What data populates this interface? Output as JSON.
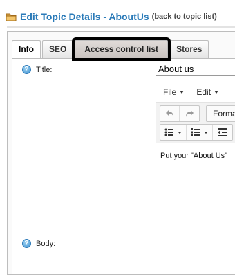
{
  "header": {
    "title": "Edit Topic Details - AboutUs",
    "back_link": "(back to topic list)"
  },
  "tabs": [
    {
      "label": "Info",
      "active": true
    },
    {
      "label": "SEO",
      "active": false
    },
    {
      "label": "Access control list",
      "active": false
    },
    {
      "label": "Stores",
      "active": false
    }
  ],
  "form": {
    "title_label": "Title:",
    "title_value": "About us",
    "body_label": "Body:"
  },
  "editor": {
    "menu": {
      "file": "File",
      "edit": "Edit"
    },
    "format_label": "Forma",
    "content": "Put your \"About Us\""
  },
  "icons": [
    "folder-icon",
    "help-icon",
    "undo-icon",
    "redo-icon",
    "bullet-list-icon",
    "numbered-list-icon",
    "outdent-icon",
    "dropdown-caret-icon"
  ],
  "colors": {
    "title": "#2a7ab8",
    "highlight_border": "#000000",
    "help_icon": "#3b8fd0"
  }
}
